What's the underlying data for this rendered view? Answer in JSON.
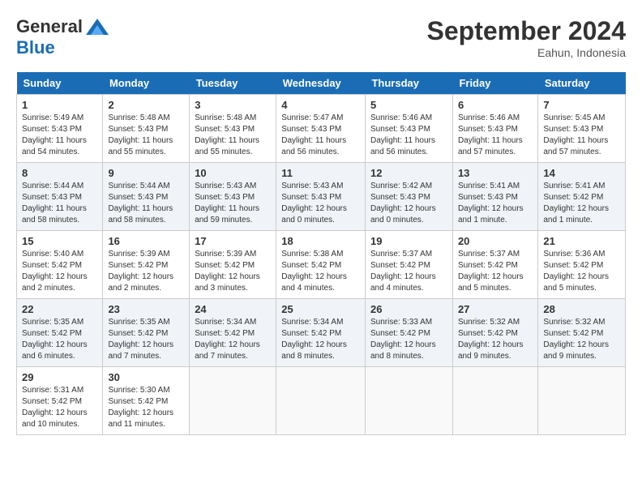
{
  "header": {
    "logo_general": "General",
    "logo_blue": "Blue",
    "month_title": "September 2024",
    "location": "Eahun, Indonesia"
  },
  "days_of_week": [
    "Sunday",
    "Monday",
    "Tuesday",
    "Wednesday",
    "Thursday",
    "Friday",
    "Saturday"
  ],
  "weeks": [
    [
      {
        "day": "1",
        "sunrise": "5:49 AM",
        "sunset": "5:43 PM",
        "daylight": "11 hours and 54 minutes."
      },
      {
        "day": "2",
        "sunrise": "5:48 AM",
        "sunset": "5:43 PM",
        "daylight": "11 hours and 55 minutes."
      },
      {
        "day": "3",
        "sunrise": "5:48 AM",
        "sunset": "5:43 PM",
        "daylight": "11 hours and 55 minutes."
      },
      {
        "day": "4",
        "sunrise": "5:47 AM",
        "sunset": "5:43 PM",
        "daylight": "11 hours and 56 minutes."
      },
      {
        "day": "5",
        "sunrise": "5:46 AM",
        "sunset": "5:43 PM",
        "daylight": "11 hours and 56 minutes."
      },
      {
        "day": "6",
        "sunrise": "5:46 AM",
        "sunset": "5:43 PM",
        "daylight": "11 hours and 57 minutes."
      },
      {
        "day": "7",
        "sunrise": "5:45 AM",
        "sunset": "5:43 PM",
        "daylight": "11 hours and 57 minutes."
      }
    ],
    [
      {
        "day": "8",
        "sunrise": "5:44 AM",
        "sunset": "5:43 PM",
        "daylight": "11 hours and 58 minutes."
      },
      {
        "day": "9",
        "sunrise": "5:44 AM",
        "sunset": "5:43 PM",
        "daylight": "11 hours and 58 minutes."
      },
      {
        "day": "10",
        "sunrise": "5:43 AM",
        "sunset": "5:43 PM",
        "daylight": "11 hours and 59 minutes."
      },
      {
        "day": "11",
        "sunrise": "5:43 AM",
        "sunset": "5:43 PM",
        "daylight": "12 hours and 0 minutes."
      },
      {
        "day": "12",
        "sunrise": "5:42 AM",
        "sunset": "5:43 PM",
        "daylight": "12 hours and 0 minutes."
      },
      {
        "day": "13",
        "sunrise": "5:41 AM",
        "sunset": "5:43 PM",
        "daylight": "12 hours and 1 minute."
      },
      {
        "day": "14",
        "sunrise": "5:41 AM",
        "sunset": "5:42 PM",
        "daylight": "12 hours and 1 minute."
      }
    ],
    [
      {
        "day": "15",
        "sunrise": "5:40 AM",
        "sunset": "5:42 PM",
        "daylight": "12 hours and 2 minutes."
      },
      {
        "day": "16",
        "sunrise": "5:39 AM",
        "sunset": "5:42 PM",
        "daylight": "12 hours and 2 minutes."
      },
      {
        "day": "17",
        "sunrise": "5:39 AM",
        "sunset": "5:42 PM",
        "daylight": "12 hours and 3 minutes."
      },
      {
        "day": "18",
        "sunrise": "5:38 AM",
        "sunset": "5:42 PM",
        "daylight": "12 hours and 4 minutes."
      },
      {
        "day": "19",
        "sunrise": "5:37 AM",
        "sunset": "5:42 PM",
        "daylight": "12 hours and 4 minutes."
      },
      {
        "day": "20",
        "sunrise": "5:37 AM",
        "sunset": "5:42 PM",
        "daylight": "12 hours and 5 minutes."
      },
      {
        "day": "21",
        "sunrise": "5:36 AM",
        "sunset": "5:42 PM",
        "daylight": "12 hours and 5 minutes."
      }
    ],
    [
      {
        "day": "22",
        "sunrise": "5:35 AM",
        "sunset": "5:42 PM",
        "daylight": "12 hours and 6 minutes."
      },
      {
        "day": "23",
        "sunrise": "5:35 AM",
        "sunset": "5:42 PM",
        "daylight": "12 hours and 7 minutes."
      },
      {
        "day": "24",
        "sunrise": "5:34 AM",
        "sunset": "5:42 PM",
        "daylight": "12 hours and 7 minutes."
      },
      {
        "day": "25",
        "sunrise": "5:34 AM",
        "sunset": "5:42 PM",
        "daylight": "12 hours and 8 minutes."
      },
      {
        "day": "26",
        "sunrise": "5:33 AM",
        "sunset": "5:42 PM",
        "daylight": "12 hours and 8 minutes."
      },
      {
        "day": "27",
        "sunrise": "5:32 AM",
        "sunset": "5:42 PM",
        "daylight": "12 hours and 9 minutes."
      },
      {
        "day": "28",
        "sunrise": "5:32 AM",
        "sunset": "5:42 PM",
        "daylight": "12 hours and 9 minutes."
      }
    ],
    [
      {
        "day": "29",
        "sunrise": "5:31 AM",
        "sunset": "5:42 PM",
        "daylight": "12 hours and 10 minutes."
      },
      {
        "day": "30",
        "sunrise": "5:30 AM",
        "sunset": "5:42 PM",
        "daylight": "12 hours and 11 minutes."
      },
      null,
      null,
      null,
      null,
      null
    ]
  ]
}
